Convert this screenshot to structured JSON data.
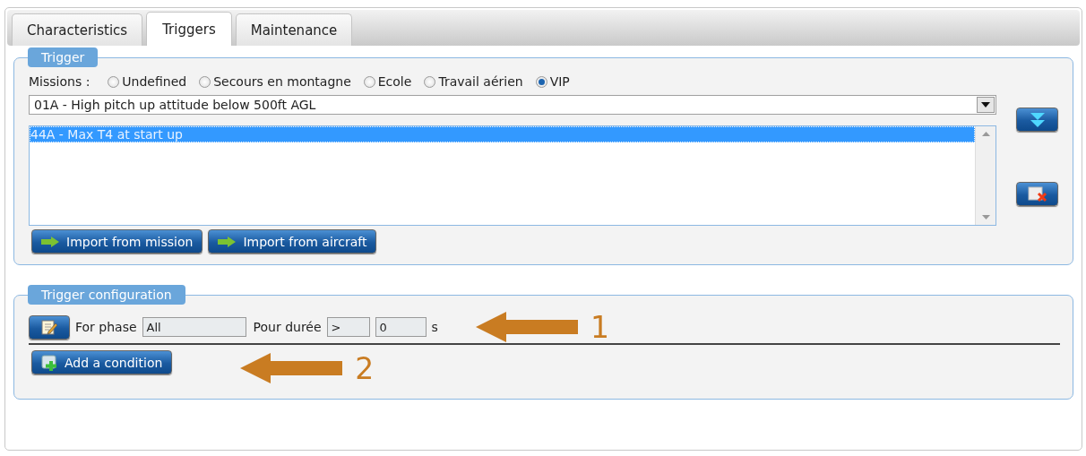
{
  "tabs": [
    {
      "label": "Characteristics",
      "selected": false
    },
    {
      "label": "Triggers",
      "selected": true
    },
    {
      "label": "Maintenance",
      "selected": false
    }
  ],
  "trigger": {
    "legend": "Trigger",
    "missions_label": "Missions :",
    "missions": [
      {
        "label": "Undefined",
        "selected": false
      },
      {
        "label": "Secours en montagne",
        "selected": false
      },
      {
        "label": "Ecole",
        "selected": false
      },
      {
        "label": "Travail aérien",
        "selected": false
      },
      {
        "label": "VIP",
        "selected": true
      }
    ],
    "dropdown": {
      "value": "01A - High pitch up attitude below 500ft AGL"
    },
    "list": [
      {
        "label": "44A - Max T4 at start up",
        "selected": true
      }
    ],
    "buttons": [
      "Import from mission",
      "Import from aircraft"
    ]
  },
  "configuration": {
    "legend": "Trigger configuration",
    "phase_label": "For phase",
    "phase": "All",
    "duration_label": "Pour durée",
    "operator": ">",
    "duration": "0",
    "unit": "s",
    "add_button": "Add a condition"
  },
  "annotations": [
    {
      "label": "1"
    },
    {
      "label": "2"
    }
  ]
}
